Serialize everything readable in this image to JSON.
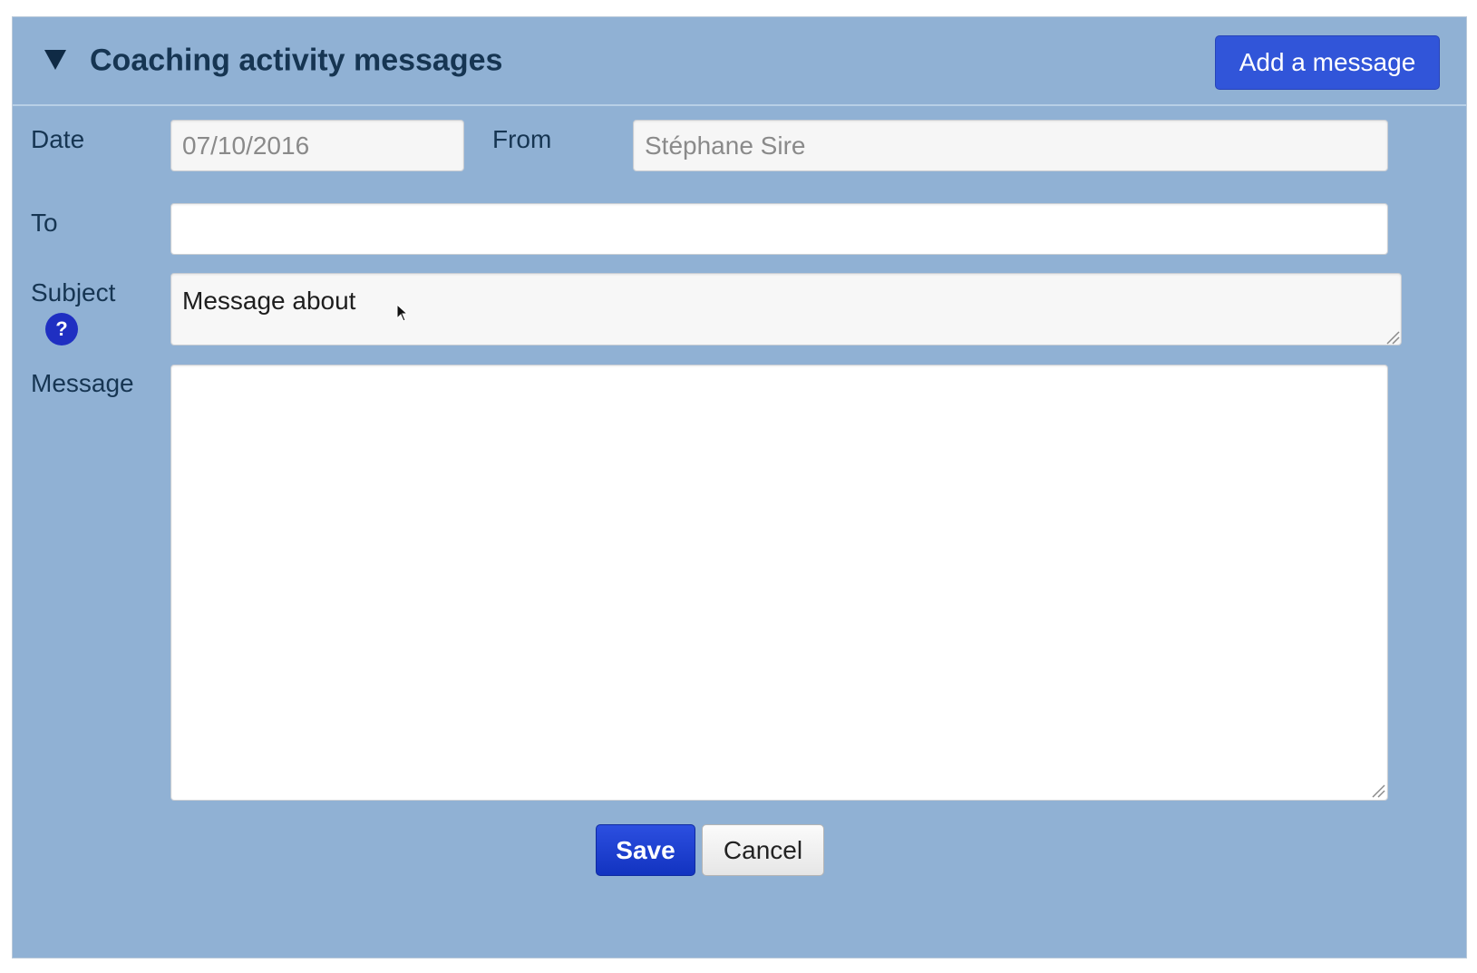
{
  "header": {
    "title": "Coaching activity messages",
    "add_button_label": "Add a message",
    "toggle_icon": "triangle-down-icon"
  },
  "form": {
    "date_label": "Date",
    "date_value": "07/10/2016",
    "from_label": "From",
    "from_value": "Stéphane Sire",
    "to_label": "To",
    "to_value": "",
    "subject_label": "Subject",
    "subject_value": "Message about",
    "help_icon": "?",
    "message_label": "Message",
    "message_value": ""
  },
  "actions": {
    "save_label": "Save",
    "cancel_label": "Cancel"
  },
  "colors": {
    "panel_background": "#90b1d4",
    "primary_button": "#3155d9",
    "save_button": "#1233c0",
    "title_text": "#163552"
  }
}
